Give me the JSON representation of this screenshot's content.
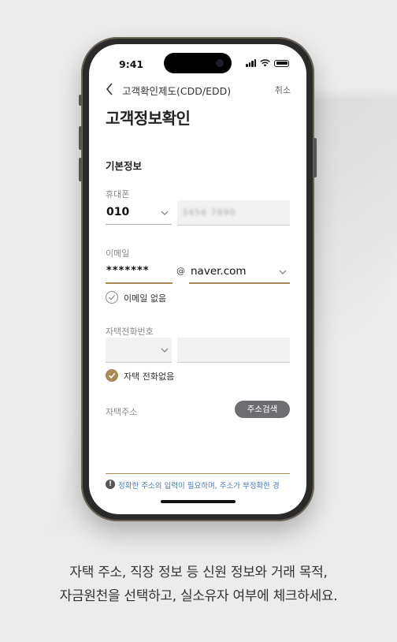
{
  "status_bar": {
    "time": "9:41"
  },
  "nav": {
    "title": "고객확인제도(CDD/EDD)",
    "cancel": "취소"
  },
  "page_title": "고객정보확인",
  "section_title": "기본정보",
  "phone_field": {
    "label": "휴대폰",
    "carrier_prefix": "010",
    "number": "3456 7890"
  },
  "email_field": {
    "label": "이메일",
    "local_part": "*******",
    "at": "@",
    "domain": "naver.com"
  },
  "no_email_checkbox": {
    "label": "이메일 없음",
    "checked": false
  },
  "home_phone_field": {
    "label": "자택전화번호",
    "prefix": "",
    "number": ""
  },
  "no_home_phone_checkbox": {
    "label": "자택 전화없음",
    "checked": true
  },
  "address_field": {
    "label": "자택주소",
    "search_button": "주소검색"
  },
  "notice": {
    "icon": "!",
    "text": "정확한 주소의 입력이 필요하며, 주소가 부정확한 경"
  },
  "caption": {
    "line1": "자택 주소, 직장 정보 등 신원 정보와 거래 목적,",
    "line2": "자금원천을 선택하고, 실소유자 여부에 체크하세요."
  },
  "colors": {
    "accent_gold": "#a88a55",
    "notice_blue": "#4a79b8",
    "button_grey": "#6e6e72"
  }
}
